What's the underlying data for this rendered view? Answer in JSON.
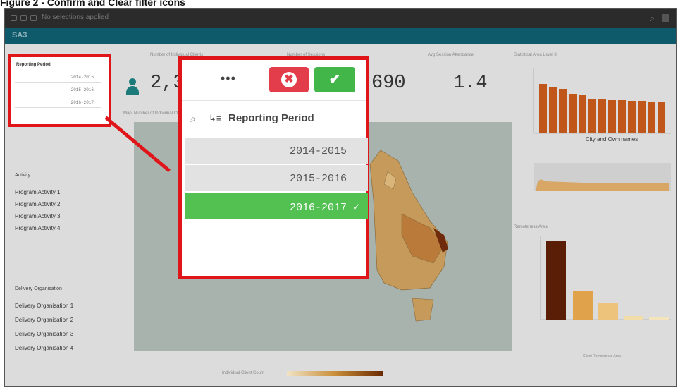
{
  "caption": "Figure 2 - Confirm and Clear filter icons",
  "topbar": {
    "selections_text": "No selections applied"
  },
  "sheet": {
    "title": "SA3"
  },
  "kpis": [
    {
      "title": "Number of Individual Clients",
      "value": "2,3"
    },
    {
      "title": "Number of Sessions",
      "value": "690"
    },
    {
      "title": "Avg Session Attendance",
      "value": "1.4"
    },
    {
      "title": "Statistical Area Level 3",
      "value": ""
    }
  ],
  "map": {
    "title": "Map: Number of Individual Clients",
    "legend_label": "Individual Client Count"
  },
  "activity": {
    "label": "Activity",
    "items": [
      "Program Activity 1",
      "Program Activity 2",
      "Program Activity 3",
      "Program Activity 4"
    ]
  },
  "delivery": {
    "label": "Delivery Organisation",
    "items": [
      "Delivery Organisation 1",
      "Delivery Organisation 2",
      "Delivery Organisation 3",
      "Delivery Organisation 4"
    ]
  },
  "right_chart": {
    "xlabel": "City and Own names"
  },
  "remoteness_chart": {
    "title": "Remoteness Area",
    "xlabel": "Client Remoteness Area"
  },
  "mini_filter": {
    "title": "Reporting Period",
    "options": [
      "2014-2015",
      "2015-2016",
      "2016-2017"
    ]
  },
  "filter_popup": {
    "more_label": "•••",
    "cancel_icon": "✖",
    "confirm_icon": "✔",
    "title": "Reporting Period",
    "options": [
      {
        "label": "2014-2015",
        "selected": false
      },
      {
        "label": "2015-2016",
        "selected": false
      },
      {
        "label": "2016-2017 ✓",
        "selected": true
      }
    ]
  },
  "colors": {
    "accent_red": "#e0151a",
    "selected_green": "#52c152",
    "teal": "#0e5a6a",
    "bar_brown": "#c0561a"
  }
}
